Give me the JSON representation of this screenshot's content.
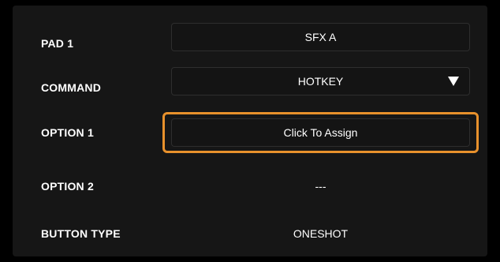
{
  "rows": {
    "pad": {
      "label": "PAD 1",
      "value": "SFX A"
    },
    "command": {
      "label": "COMMAND",
      "value": "HOTKEY",
      "icon": "triangle-down-icon"
    },
    "option1": {
      "label": "OPTION 1",
      "value": "Click To Assign"
    },
    "option2": {
      "label": "OPTION 2",
      "value": "---"
    },
    "button_type": {
      "label": "BUTTON TYPE",
      "value": "ONESHOT"
    }
  },
  "colors": {
    "background": "#000000",
    "panel": "#161616",
    "field_border": "#2e2e2e",
    "highlight": "#e8912c",
    "text": "#ffffff"
  }
}
